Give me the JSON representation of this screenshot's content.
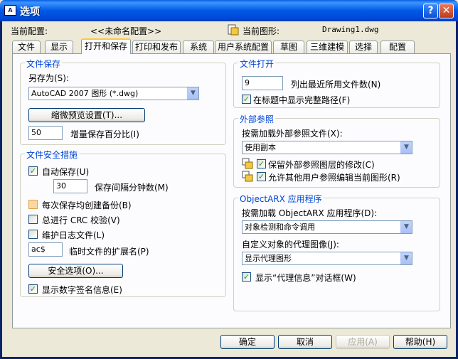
{
  "window": {
    "title": "选项"
  },
  "header": {
    "current_profile_label": "当前配置:",
    "current_profile_value": "<<未命名配置>>",
    "current_drawing_label": "当前图形:",
    "current_drawing_value": "Drawing1.dwg"
  },
  "tabs": [
    "文件",
    "显示",
    "打开和保存",
    "打印和发布",
    "系统",
    "用户系统配置",
    "草图",
    "三维建模",
    "选择",
    "配置"
  ],
  "file_save": {
    "title": "文件保存",
    "save_as_label": "另存为(S):",
    "save_as_value": "AutoCAD 2007 图形 (*.dwg)",
    "thumbnail_button": "缩微预览设置(T)...",
    "incremental_value": "50",
    "incremental_label": "增量保存百分比(I)"
  },
  "file_safety": {
    "title": "文件安全措施",
    "autosave_label": "自动保存(U)",
    "autosave_checked": true,
    "interval_value": "30",
    "interval_label": "保存间隔分钟数(M)",
    "backup_label": "每次保存均创建备份(B)",
    "backup_checked": false,
    "crc_label": "总进行 CRC 校验(V)",
    "crc_checked": false,
    "log_label": "维护日志文件(L)",
    "log_checked": false,
    "ext_value": "ac$",
    "ext_label": "临时文件的扩展名(P)",
    "security_button": "安全选项(O)...",
    "signature_label": "显示数字签名信息(E)",
    "signature_checked": true
  },
  "file_open": {
    "title": "文件打开",
    "recent_value": "9",
    "recent_label": "列出最近所用文件数(N)",
    "fullpath_label": "在标题中显示完整路径(F)",
    "fullpath_checked": true
  },
  "xref": {
    "title": "外部参照",
    "demand_label": "按需加载外部参照文件(X):",
    "demand_value": "使用副本",
    "retain_label": "保留外部参照图层的修改(C)",
    "retain_checked": true,
    "allow_label": "允许其他用户参照编辑当前图形(R)",
    "allow_checked": true
  },
  "objectarx": {
    "title": "ObjectARX 应用程序",
    "demand_label": "按需加载 ObjectARX 应用程序(D):",
    "demand_value": "对象检测和命令调用",
    "proxy_label": "自定义对象的代理图像(J):",
    "proxy_value": "显示代理图形",
    "proxy_dialog_label": "显示“代理信息”对话框(W)",
    "proxy_dialog_checked": true
  },
  "footer": {
    "ok": "确定",
    "cancel": "取消",
    "apply": "应用(A)",
    "help": "帮助(H)"
  }
}
